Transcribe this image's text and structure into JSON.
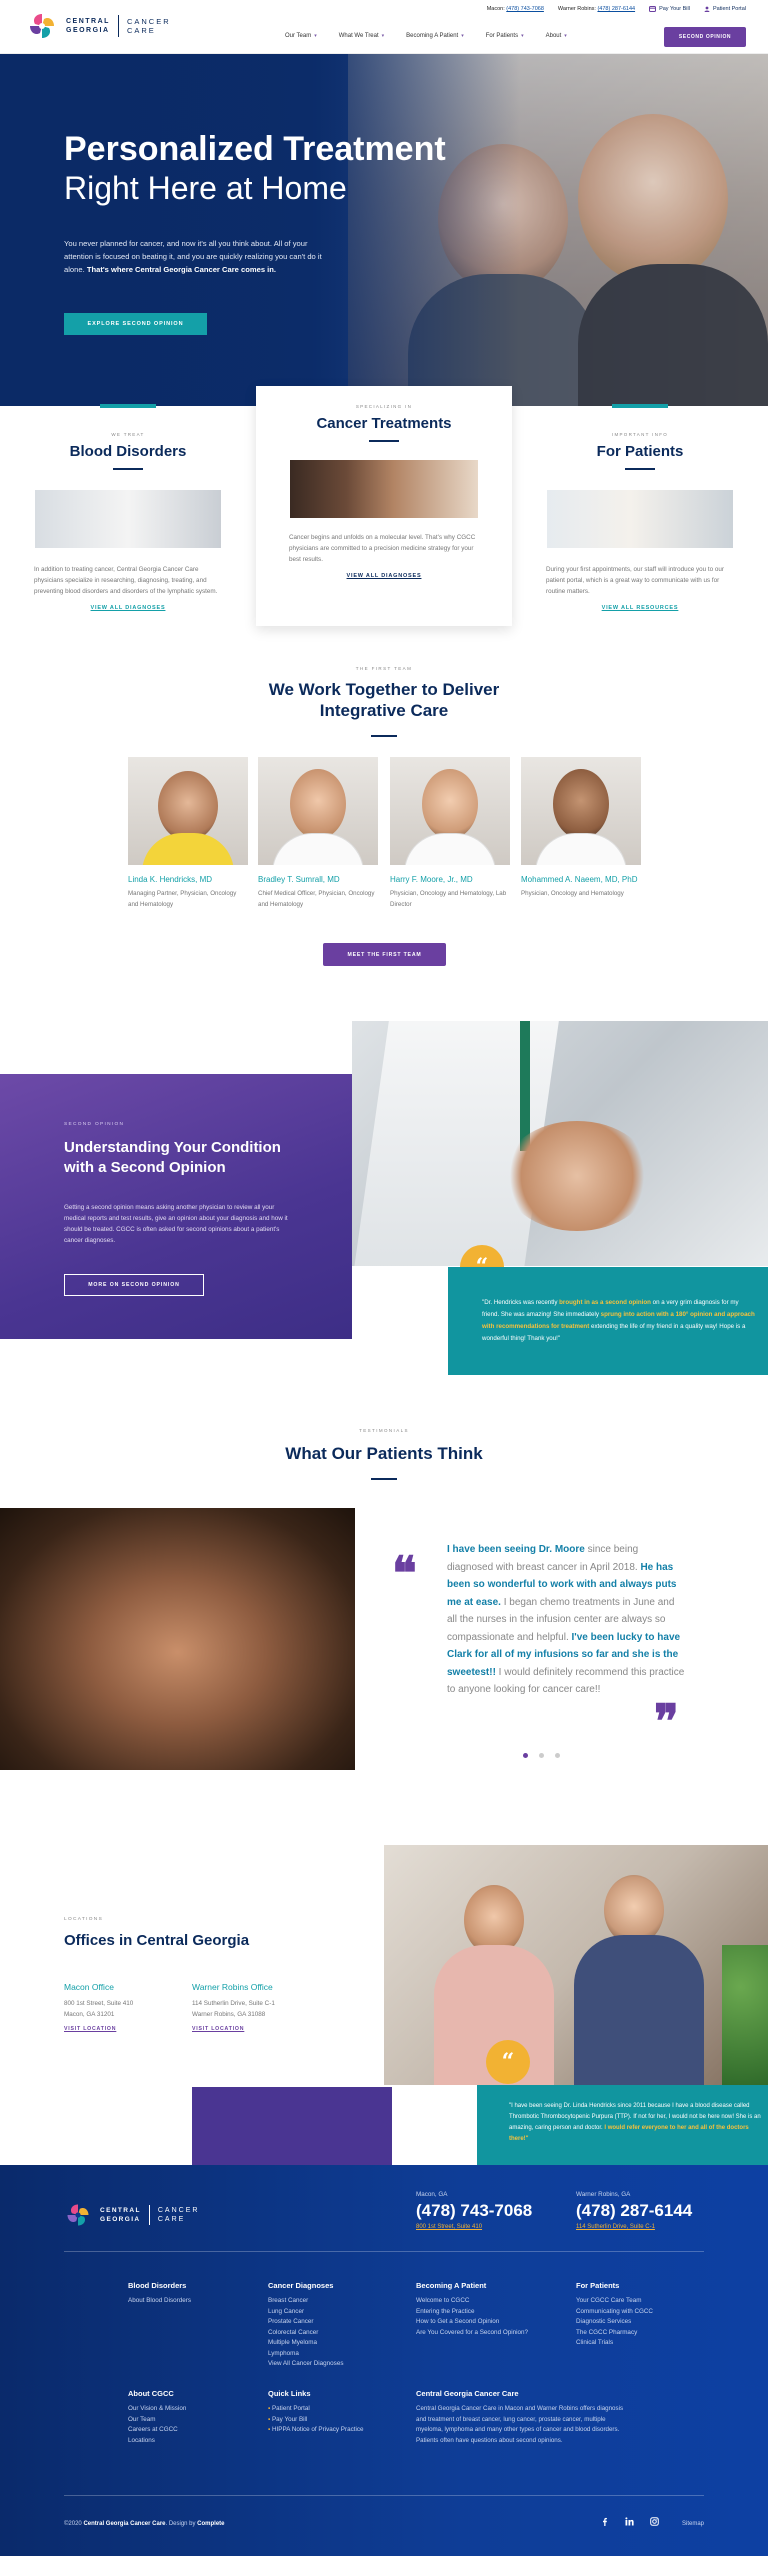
{
  "header": {
    "logo_line1": "CENTRAL",
    "logo_line2": "GEORGIA",
    "logo_line3": "CANCER",
    "logo_line4": "CARE",
    "macon_label": "Macon:",
    "macon_phone": "(478) 743-7068",
    "warner_label": "Warner Robins:",
    "warner_phone": "(478) 287-6144",
    "pay_bill": "Pay Your Bill",
    "patient_portal": "Patient Portal",
    "nav": [
      "Our Team",
      "What We Treat",
      "Becoming A Patient",
      "For Patients",
      "About"
    ],
    "cta": "SECOND OPINION"
  },
  "hero": {
    "title1": "Personalized Treatment",
    "title2": "Right Here at Home",
    "body": "You never planned for cancer, and now it's all you think about. All of your attention is focused on beating it, and you are quickly realizing you can't do it alone.",
    "body_bold": "That's where Central Georgia Cancer Care comes in.",
    "button": "EXPLORE SECOND OPINION"
  },
  "cards": [
    {
      "eyebrow": "WE TREAT",
      "title": "Blood Disorders",
      "text": "In addition to treating cancer, Central Georgia Cancer Care physicians specialize in researching, diagnosing, treating, and preventing blood disorders and disorders of the lymphatic system.",
      "link": "VIEW ALL DIAGNOSES"
    },
    {
      "eyebrow": "SPECIALIZING IN",
      "title": "Cancer Treatments",
      "text": "Cancer begins and unfolds on a molecular level. That's why CGCC physicians are committed to a precision medicine strategy for your best results.",
      "link": "VIEW ALL DIAGNOSES"
    },
    {
      "eyebrow": "IMPORTANT INFO",
      "title": "For Patients",
      "text": "During your first appointments, our staff will introduce you to our patient portal, which is a great way to communicate with us for routine matters.",
      "link": "VIEW ALL RESOURCES"
    }
  ],
  "team": {
    "eyebrow": "THE FIRST TEAM",
    "title1": "We Work Together to Deliver",
    "title2": "Integrative Care",
    "button": "MEET THE FIRST TEAM",
    "doctors": [
      {
        "name": "Linda K. Hendricks, MD",
        "role": "Managing Partner, Physician, Oncology and Hematology"
      },
      {
        "name": "Bradley T. Sumrall, MD",
        "role": "Chief Medical Officer, Physician, Oncology and Hematology"
      },
      {
        "name": "Harry F. Moore, Jr., MD",
        "role": "Physician, Oncology and Hematology, Lab Director"
      },
      {
        "name": "Mohammed A. Naeem, MD, PhD",
        "role": "Physician, Oncology and Hematology"
      }
    ]
  },
  "second_opinion": {
    "eyebrow": "SECOND OPINION",
    "title1": "Understanding Your Condition",
    "title2": "with a Second Opinion",
    "body": "Getting a second opinion means asking another physician to review all your medical reports and test results, give an opinion about your diagnosis and how it should be treated. CGCC is often asked for second opinions about a patient's cancer diagnoses.",
    "button": "MORE ON SECOND OPINION",
    "quote_a": "\"Dr. Hendricks was recently ",
    "quote_b": "brought in as a second opinion",
    "quote_c": " on a very grim diagnosis for my friend. She was amazing! She immediately ",
    "quote_d": "sprung into action with a 180° opinion and approach with recommendations for treatment",
    "quote_e": " extending the life of my friend in a quality way! Hope is a wonderful thing! Thank you!\""
  },
  "testimonials": {
    "eyebrow": "TESTIMONIALS",
    "title": "What Our Patients Think",
    "q1": "I have been seeing Dr. Moore",
    "q2": " since being diagnosed with breast cancer in April 2018. ",
    "q3": "He has been so wonderful to work with and always puts me at ease.",
    "q4": " I began chemo treatments in June and all the nurses in the infusion center are always so compassionate and helpful. ",
    "q5": "I've been lucky to have Clark for all of my infusions so far and she is the sweetest!!",
    "q6": " I would definitely recommend this practice to anyone looking for cancer care!!"
  },
  "offices": {
    "eyebrow": "LOCATIONS",
    "title": "Offices in Central Georgia",
    "list": [
      {
        "name": "Macon Office",
        "line1": "800 1st Street, Suite 410",
        "line2": "Macon, GA 31201",
        "link": "VISIT LOCATION"
      },
      {
        "name": "Warner Robins Office",
        "line1": "114 Sutherlin Drive, Suite C-1",
        "line2": "Warner Robins, GA 31088",
        "link": "VISIT LOCATION"
      }
    ],
    "quote_a": "\"I have been seeing Dr. Linda Hendricks since 2011 because I have a blood disease called Thrombotic Thrombocytopenic Purpura (TTP). If not for her, I would not be here now! She is an amazing, caring person and doctor. ",
    "quote_b": "I would refer everyone to her and all of the doctors there!\""
  },
  "footer": {
    "logo_line1": "CENTRAL",
    "logo_line2": "GEORGIA",
    "logo_line3": "CANCER",
    "logo_line4": "CARE",
    "macon_city": "Macon, GA",
    "macon_phone": "(478) 743-7068",
    "macon_addr": "800 1st Street, Suite 410",
    "warner_city": "Warner Robins, GA",
    "warner_phone": "(478) 287-6144",
    "warner_addr": "114 Sutherlin Drive, Suite C-1",
    "cols": [
      {
        "title": "Blood Disorders",
        "items": [
          "About Blood Disorders"
        ]
      },
      {
        "title": "Cancer Diagnoses",
        "items": [
          "Breast Cancer",
          "Lung Cancer",
          "Prostate Cancer",
          "Colorectal Cancer",
          "Multiple Myeloma",
          "Lymphoma",
          "View All Cancer Diagnoses"
        ]
      },
      {
        "title": "Becoming A Patient",
        "items": [
          "Welcome to CGCC",
          "Entering the Practice",
          "How to Get a Second Opinion",
          "Are You Covered for a Second Opinion?"
        ]
      },
      {
        "title": "For Patients",
        "items": [
          "Your CGCC Care Team",
          "Communicating with CGCC",
          "Diagnostic Services",
          "The CGCC Pharmacy",
          "Clinical Trials"
        ]
      },
      {
        "title": "About CGCC",
        "items": [
          "Our Vision & Mission",
          "Our Team",
          "Careers at CGCC",
          "Locations"
        ]
      },
      {
        "title": "Quick Links",
        "items": [
          "Patient Portal",
          "Pay Your Bill",
          "HIPPA Notice of Privacy Practice"
        ]
      }
    ],
    "about_title": "Central Georgia Cancer Care",
    "about_text": "Central Georgia Cancer Care in Macon and Warner Robins offers diagnosis and treatment of breast cancer, lung cancer, prostate cancer, multiple myeloma, lymphoma and many other types of cancer and blood disorders. Patients often have questions about second opinions.",
    "copyright": "©2020",
    "copyright_name": "Central Georgia Cancer Care",
    "design_by": ". Design by",
    "designer": "Complete",
    "sitemap": "Sitemap"
  },
  "colors": {
    "navy": "#0b2a5b",
    "teal": "#14a0a8",
    "purple": "#6a3fa0",
    "gold": "#f2b233"
  }
}
